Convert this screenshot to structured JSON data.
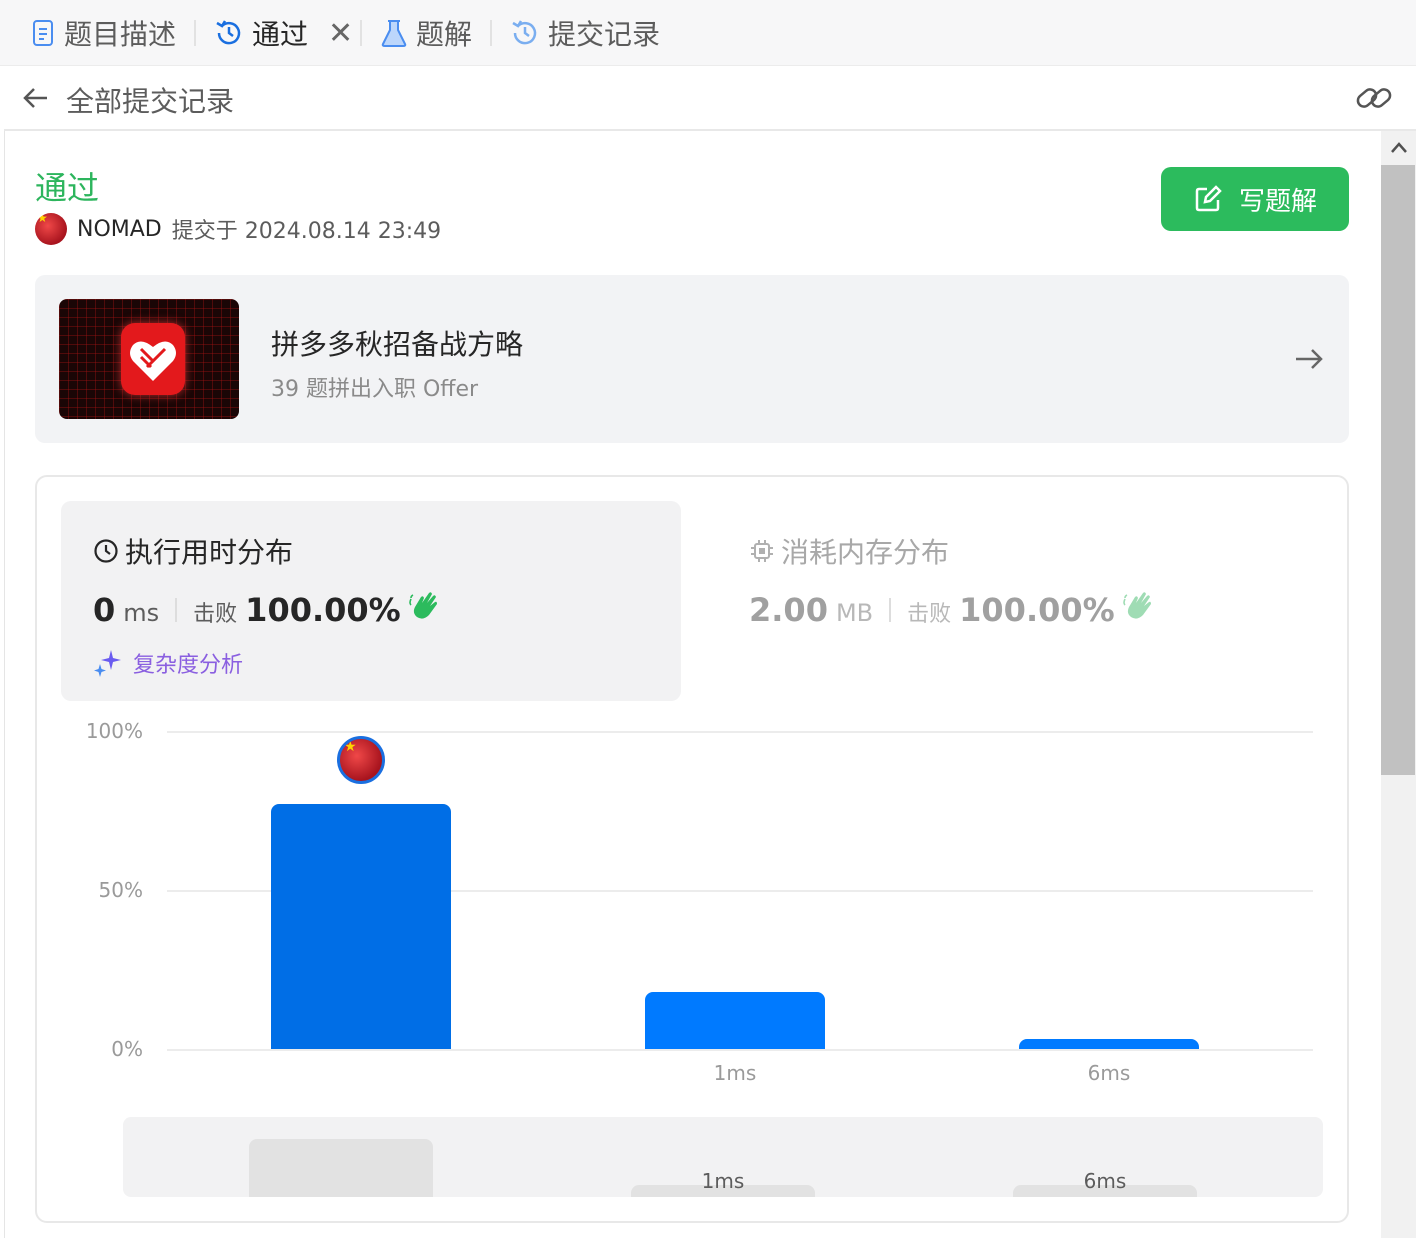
{
  "tabs": [
    {
      "label": "题目描述",
      "icon": "document-icon"
    },
    {
      "label": "通过",
      "icon": "history-icon",
      "active": true
    },
    {
      "label": "题解",
      "icon": "flask-icon"
    },
    {
      "label": "提交记录",
      "icon": "history-icon"
    }
  ],
  "subheader": {
    "title": "全部提交记录"
  },
  "submission": {
    "status": "通过",
    "user": "NOMAD",
    "submitted_text": "提交于 2024.08.14 23:49",
    "write_solution_label": "写题解"
  },
  "promo": {
    "title": "拼多多秋招备战方略",
    "subtitle": "39 题拼出入职 Offer"
  },
  "runtime": {
    "title": "执行用时分布",
    "value": "0",
    "unit": "ms",
    "beat_label": "击败",
    "beat_value": "100.00%",
    "analysis_label": "复杂度分析"
  },
  "memory": {
    "title": "消耗内存分布",
    "value": "2.00",
    "unit": "MB",
    "beat_label": "击败",
    "beat_value": "100.00%"
  },
  "colors": {
    "accent_green": "#2cbb5d",
    "bar_selected": "#006ee6",
    "bar": "#007aff"
  },
  "chart_data": {
    "type": "bar",
    "categories": [
      "",
      "1ms",
      "6ms"
    ],
    "values": [
      77,
      18,
      3
    ],
    "ylim": [
      0,
      100
    ],
    "yticks": [
      "100%",
      "50%",
      "0%"
    ],
    "selected_index": 0
  }
}
